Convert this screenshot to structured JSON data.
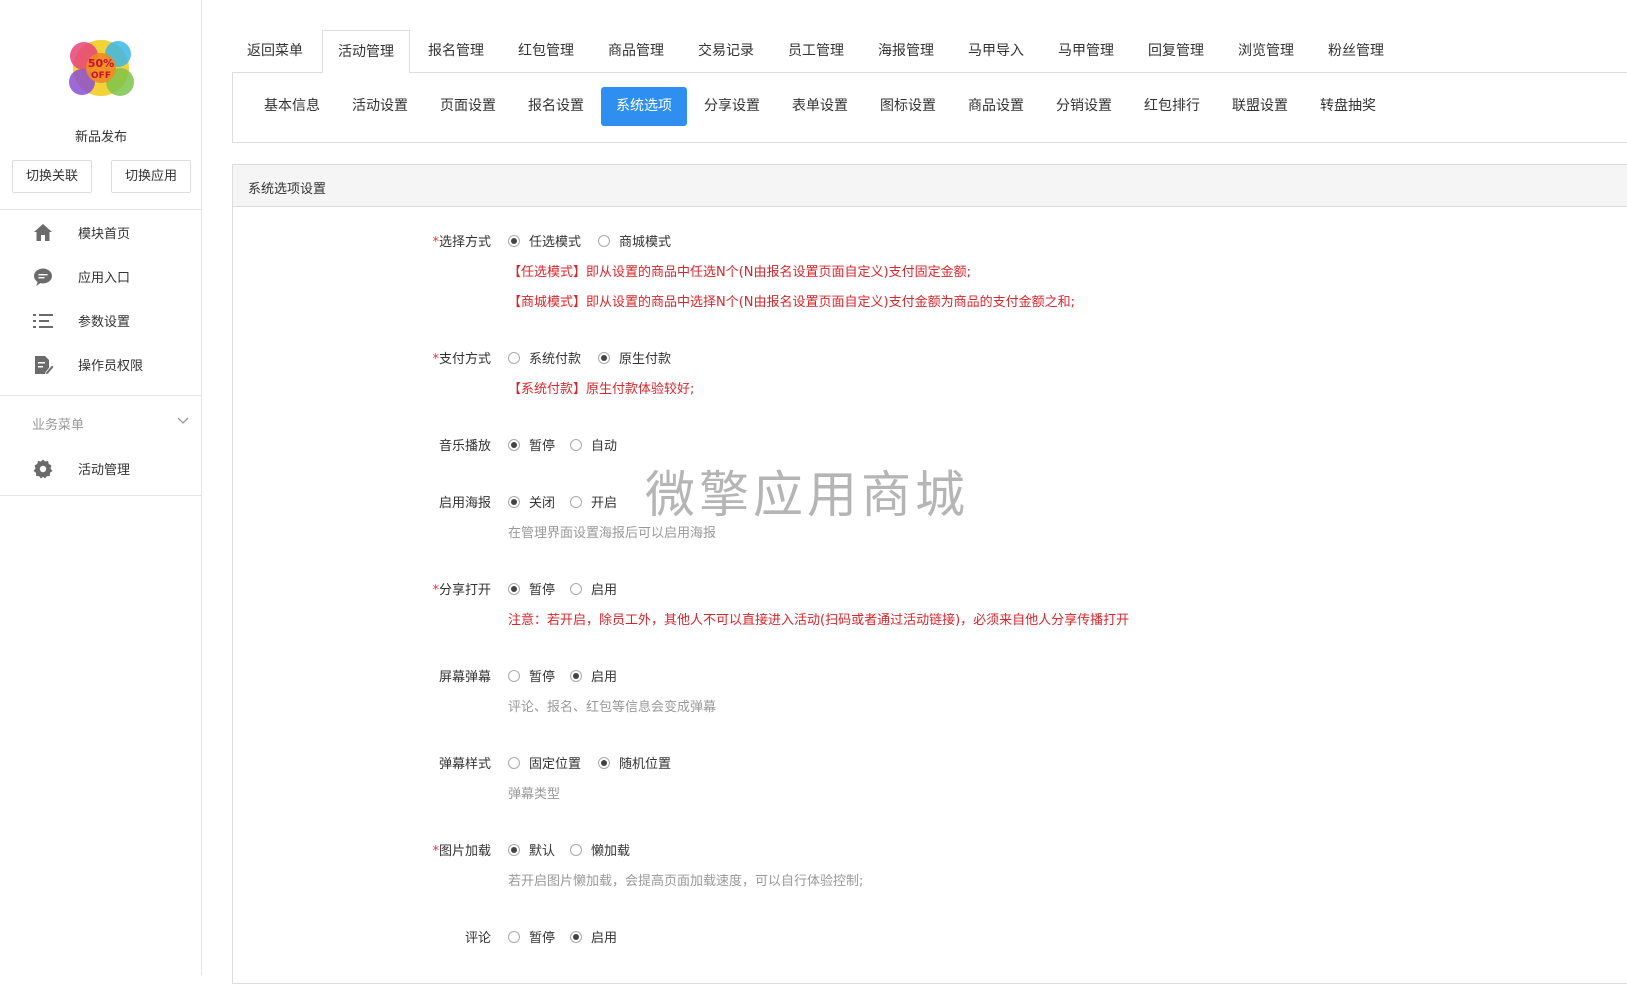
{
  "sidebar": {
    "app_name": "新品发布",
    "logo_text": "50% OFF",
    "switch_link_label": "切换关联",
    "switch_app_label": "切换应用",
    "items": [
      {
        "label": "模块首页",
        "icon": "home-icon"
      },
      {
        "label": "应用入口",
        "icon": "chat-icon"
      },
      {
        "label": "参数设置",
        "icon": "list-icon"
      },
      {
        "label": "操作员权限",
        "icon": "edit-doc-icon"
      }
    ],
    "section_label": "业务菜单",
    "section_items": [
      {
        "label": "活动管理",
        "icon": "gear-icon"
      }
    ]
  },
  "top_tabs": [
    "返回菜单",
    "活动管理",
    "报名管理",
    "红包管理",
    "商品管理",
    "交易记录",
    "员工管理",
    "海报管理",
    "马甲导入",
    "马甲管理",
    "回复管理",
    "浏览管理",
    "粉丝管理"
  ],
  "top_tabs_active": "活动管理",
  "sub_tabs": [
    "基本信息",
    "活动设置",
    "页面设置",
    "报名设置",
    "系统选项",
    "分享设置",
    "表单设置",
    "图标设置",
    "商品设置",
    "分销设置",
    "红包排行",
    "联盟设置",
    "转盘抽奖"
  ],
  "sub_tabs_active": "系统选项",
  "panel_title": "系统选项设置",
  "form": {
    "select_mode": {
      "required": "*",
      "label": "选择方式",
      "options": [
        "任选模式",
        "商城模式"
      ],
      "selected": "任选模式",
      "hints": [
        "【任选模式】即从设置的商品中任选N个(N由报名设置页面自定义)支付固定金额;",
        "【商城模式】即从设置的商品中选择N个(N由报名设置页面自定义)支付金额为商品的支付金额之和;"
      ]
    },
    "pay_mode": {
      "required": "*",
      "label": "支付方式",
      "options": [
        "系统付款",
        "原生付款"
      ],
      "selected": "原生付款",
      "hint": "【系统付款】原生付款体验较好;"
    },
    "music": {
      "label": "音乐播放",
      "options": [
        "暂停",
        "自动"
      ],
      "selected": "暂停"
    },
    "poster": {
      "label": "启用海报",
      "options": [
        "关闭",
        "开启"
      ],
      "selected": "关闭",
      "hint": "在管理界面设置海报后可以启用海报"
    },
    "share_open": {
      "required": "*",
      "label": "分享打开",
      "options": [
        "暂停",
        "启用"
      ],
      "selected": "暂停",
      "hint": "注意：若开启，除员工外，其他人不可以直接进入活动(扫码或者通过活动链接)，必须来自他人分享传播打开"
    },
    "barrage": {
      "label": "屏幕弹幕",
      "options": [
        "暂停",
        "启用"
      ],
      "selected": "启用",
      "hint": "评论、报名、红包等信息会变成弹幕"
    },
    "barrage_style": {
      "label": "弹幕样式",
      "options": [
        "固定位置",
        "随机位置"
      ],
      "selected": "随机位置",
      "hint": "弹幕类型"
    },
    "image_load": {
      "required": "*",
      "label": "图片加载",
      "options": [
        "默认",
        "懒加载"
      ],
      "selected": "默认",
      "hint": "若开启图片懒加载，会提高页面加载速度，可以自行体验控制;"
    },
    "comment": {
      "label": "评论",
      "options": [
        "暂停",
        "启用"
      ],
      "selected": "启用"
    }
  },
  "watermark": "微擎应用商城",
  "colors": {
    "accent": "#2f8ff0",
    "hint_red": "#d9262c",
    "hint_grey": "#999999",
    "required": "#e33333"
  }
}
